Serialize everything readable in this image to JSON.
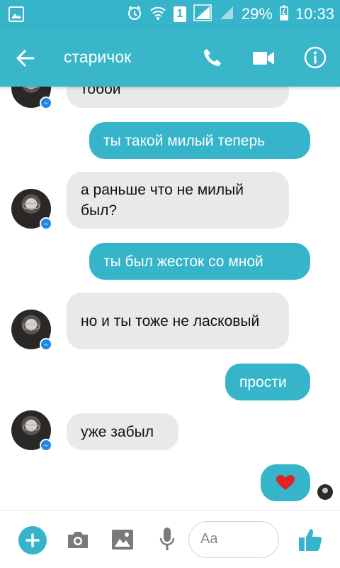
{
  "colors": {
    "accent": "#36b4c9",
    "incoming_bubble": "#e9e9ec",
    "messenger_badge": "#1e88e5",
    "heart": "#e02424"
  },
  "status_bar": {
    "sim": "1",
    "battery": "29%",
    "time": "10:33"
  },
  "header": {
    "contact_name": "старичок"
  },
  "messages": [
    {
      "from": "them",
      "text": "тобой"
    },
    {
      "from": "me",
      "text": "ты такой милый теперь"
    },
    {
      "from": "them",
      "text": "а раньше что не милый был?"
    },
    {
      "from": "me",
      "text": "ты был жесток со мной"
    },
    {
      "from": "them",
      "text": "но и ты тоже не ласковый"
    },
    {
      "from": "me",
      "text": "прости"
    },
    {
      "from": "them",
      "text": "уже забыл"
    },
    {
      "from": "me",
      "type": "emoji",
      "icon": "heart-icon"
    }
  ],
  "composer": {
    "placeholder": "Aa"
  }
}
